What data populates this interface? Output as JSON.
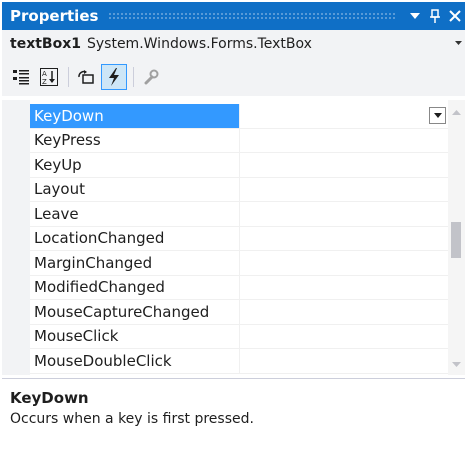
{
  "window": {
    "title": "Properties",
    "dropdown_icon": "chevron-down-icon",
    "pin_icon": "pin-icon",
    "close_icon": "close-icon"
  },
  "object_selector": {
    "name": "textBox1",
    "type": "System.Windows.Forms.TextBox"
  },
  "toolbar": {
    "buttons": [
      {
        "name": "categorized-button",
        "icon": "categorized-icon"
      },
      {
        "name": "alphabetical-button",
        "icon": "alphabetical-icon"
      },
      {
        "name": "properties-button",
        "icon": "properties-icon"
      },
      {
        "name": "events-button",
        "icon": "lightning-icon",
        "active": true
      },
      {
        "name": "property-pages-button",
        "icon": "wrench-icon",
        "disabled": true
      }
    ]
  },
  "grid": {
    "rows": [
      {
        "name": "KeyDown",
        "value": "",
        "selected": true
      },
      {
        "name": "KeyPress",
        "value": ""
      },
      {
        "name": "KeyUp",
        "value": ""
      },
      {
        "name": "Layout",
        "value": ""
      },
      {
        "name": "Leave",
        "value": ""
      },
      {
        "name": "LocationChanged",
        "value": ""
      },
      {
        "name": "MarginChanged",
        "value": ""
      },
      {
        "name": "ModifiedChanged",
        "value": ""
      },
      {
        "name": "MouseCaptureChanged",
        "value": ""
      },
      {
        "name": "MouseClick",
        "value": ""
      },
      {
        "name": "MouseDoubleClick",
        "value": ""
      }
    ]
  },
  "description": {
    "title": "KeyDown",
    "text": "Occurs when a key is first pressed."
  },
  "colors": {
    "title_bar": "#0f6fc6",
    "selection": "#3399ff",
    "panel_bg": "#f2f3f5"
  }
}
